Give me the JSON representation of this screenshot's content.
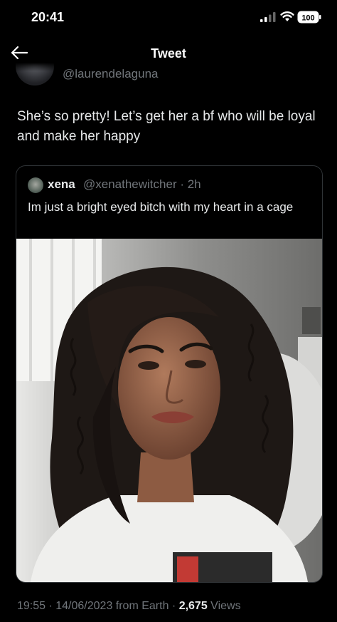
{
  "status_bar": {
    "time": "20:41",
    "battery": "100"
  },
  "nav": {
    "title": "Tweet"
  },
  "author": {
    "handle": "@laurendelaguna"
  },
  "tweet": {
    "text": "She’s so pretty! Let’s get her a bf who will be loyal and make her happy"
  },
  "quoted": {
    "name": "xena",
    "handle_time": "@xenathewitcher · 2h",
    "text": "Im just a bright eyed bitch with my heart in a cage"
  },
  "meta": {
    "time_date": "19:55 · 14/06/2023 from Earth · ",
    "views_count": "2,675",
    "views_label": " Views"
  },
  "icons": {
    "back": "arrow-left-icon",
    "signal": "cellular-signal-icon",
    "wifi": "wifi-icon",
    "battery": "battery-icon"
  },
  "colors": {
    "background": "#000000",
    "text": "#e7e9ea",
    "secondary_text": "#71767b",
    "border": "#2f3336"
  }
}
